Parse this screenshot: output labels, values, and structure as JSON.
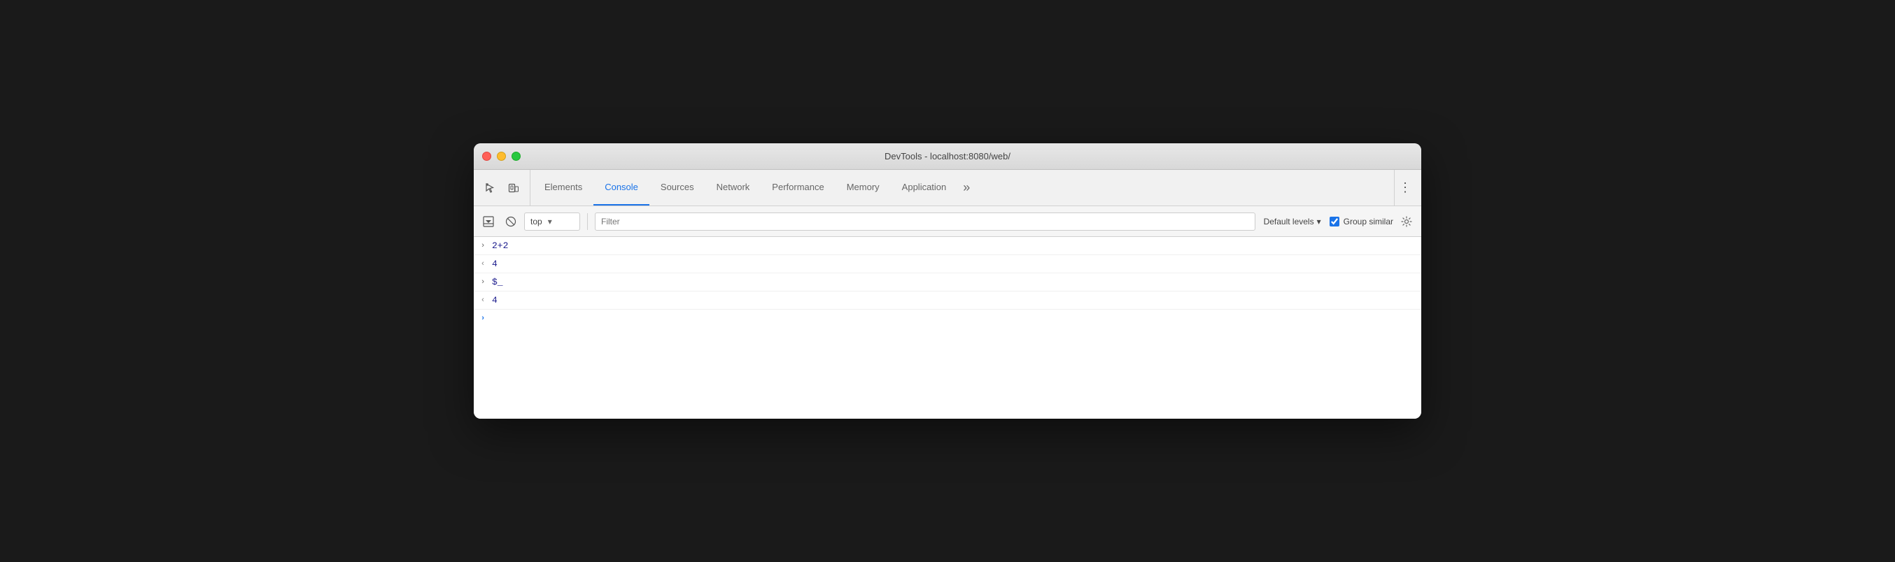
{
  "window": {
    "title": "DevTools - localhost:8080/web/"
  },
  "traffic_lights": {
    "close_label": "close",
    "minimize_label": "minimize",
    "maximize_label": "maximize"
  },
  "tabs": [
    {
      "id": "elements",
      "label": "Elements",
      "active": false
    },
    {
      "id": "console",
      "label": "Console",
      "active": true
    },
    {
      "id": "sources",
      "label": "Sources",
      "active": false
    },
    {
      "id": "network",
      "label": "Network",
      "active": false
    },
    {
      "id": "performance",
      "label": "Performance",
      "active": false
    },
    {
      "id": "memory",
      "label": "Memory",
      "active": false
    },
    {
      "id": "application",
      "label": "Application",
      "active": false
    }
  ],
  "tab_more_label": "»",
  "toolbar": {
    "context_value": "top",
    "context_dropdown": "▾",
    "filter_placeholder": "Filter",
    "levels_label": "Default levels",
    "levels_dropdown": "▾",
    "group_similar_label": "Group similar",
    "group_similar_checked": true
  },
  "console_rows": [
    {
      "direction": ">",
      "text": "2+2",
      "type": "input"
    },
    {
      "direction": "<",
      "text": "4",
      "type": "output"
    },
    {
      "direction": ">",
      "text": "$_",
      "type": "input"
    },
    {
      "direction": "<",
      "text": "4",
      "type": "output"
    }
  ],
  "prompt": {
    "direction": ">",
    "value": ""
  }
}
